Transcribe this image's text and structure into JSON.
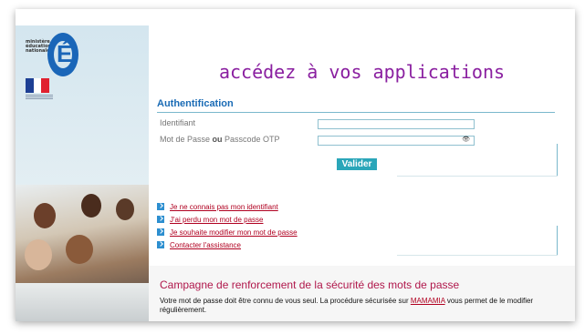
{
  "header": {
    "title": "accédez à vos applications",
    "logo_lines": [
      "ministère",
      "éducation",
      "nationale"
    ],
    "logo_letter": "É"
  },
  "auth": {
    "title": "Authentification",
    "identifier_label": "Identifiant",
    "identifier_value": "",
    "password_label_part1": "Mot de Passe ",
    "password_label_bold": "ou",
    "password_label_part2": " Passcode OTP",
    "password_value": "",
    "eye_glyph": "👁",
    "submit_label": "Valider"
  },
  "links": [
    "Je ne connais pas mon identifiant",
    "J'ai perdu mon mot de passe",
    "Je souhaite modifier mon mot de passe",
    "Contacter l'assistance"
  ],
  "campaign": {
    "title": "Campagne de renforcement de la sécurité des mots de passe",
    "text_before": "Votre mot de passe doit être connu de vous seul. La procédure sécurisée sur ",
    "link": "MAMAMIA",
    "text_after": " vous permet de le modifier régulièrement."
  },
  "colors": {
    "title": "#8a1fa0",
    "auth_title": "#1a6bb5",
    "link": "#b00020",
    "button": "#2aa6b9",
    "campaign_title": "#b0174b",
    "flag": [
      "#1d3f94",
      "#ffffff",
      "#e0202f"
    ]
  }
}
